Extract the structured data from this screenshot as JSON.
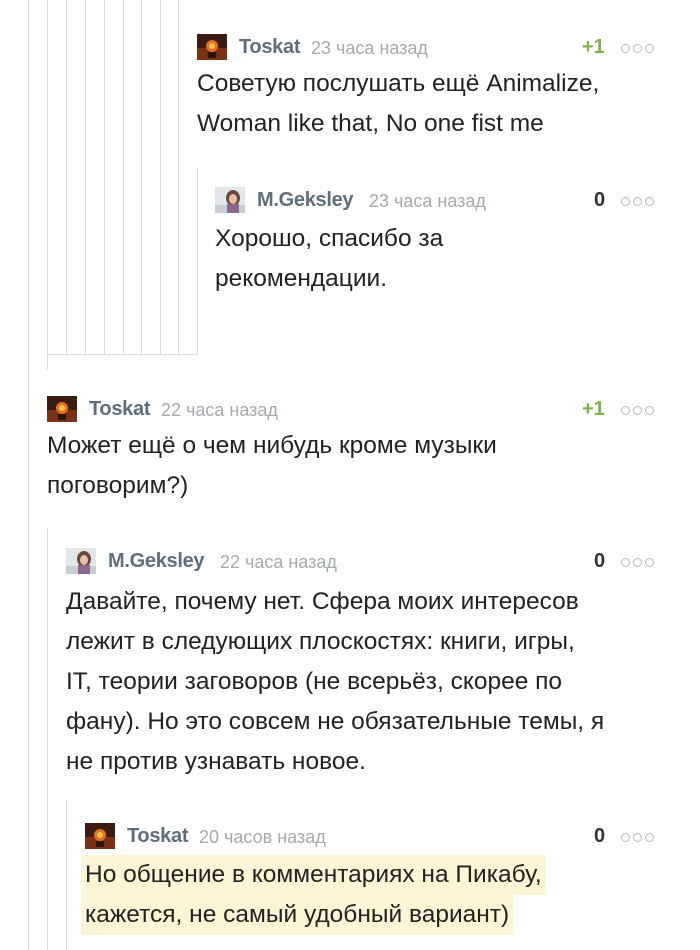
{
  "comments": [
    {
      "author": "Toskat",
      "time": "23 часа назад",
      "rating": "+1",
      "avatar_icon": "toskat-avatar-icon",
      "lines": [
        "Советую послушать ещё Animalize,",
        "Woman like that, No one fist me"
      ]
    },
    {
      "author": "M.Geksley",
      "time": "23 часа назад",
      "rating": "0",
      "avatar_icon": "geksley-avatar-icon",
      "lines": [
        "Хорошо, спасибо за",
        "рекомендации."
      ]
    },
    {
      "author": "Toskat",
      "time": "22 часа назад",
      "rating": "+1",
      "avatar_icon": "toskat-avatar-icon",
      "lines": [
        "Может ещё о чем нибудь кроме музыки",
        "поговорим?)"
      ]
    },
    {
      "author": "M.Geksley",
      "time": "22 часа назад",
      "rating": "0",
      "avatar_icon": "geksley-avatar-icon",
      "lines": [
        "Давайте, почему нет. Сфера моих интересов",
        "лежит в следующих плоскостях: книги, игры,",
        "IT, теории заговоров (не всерьёз, скорее по",
        "фану). Но это совсем не обязательные темы, я",
        "не против узнавать новое."
      ]
    },
    {
      "author": "Toskat",
      "time": "20 часов назад",
      "rating": "0",
      "avatar_icon": "toskat-avatar-icon",
      "highlighted": true,
      "lines": [
        "Но общение в комментариях на Пикабу,",
        "кажется, не самый удобный вариант)"
      ]
    }
  ],
  "colors": {
    "author": "#5e6e7e",
    "time": "#a5aaae",
    "rating_positive": "#7fb14a",
    "rating_zero": "#333333",
    "thread_line": "#dcdcdc",
    "highlight": "#fbf5d6"
  },
  "more_icon": "more-dots-icon"
}
